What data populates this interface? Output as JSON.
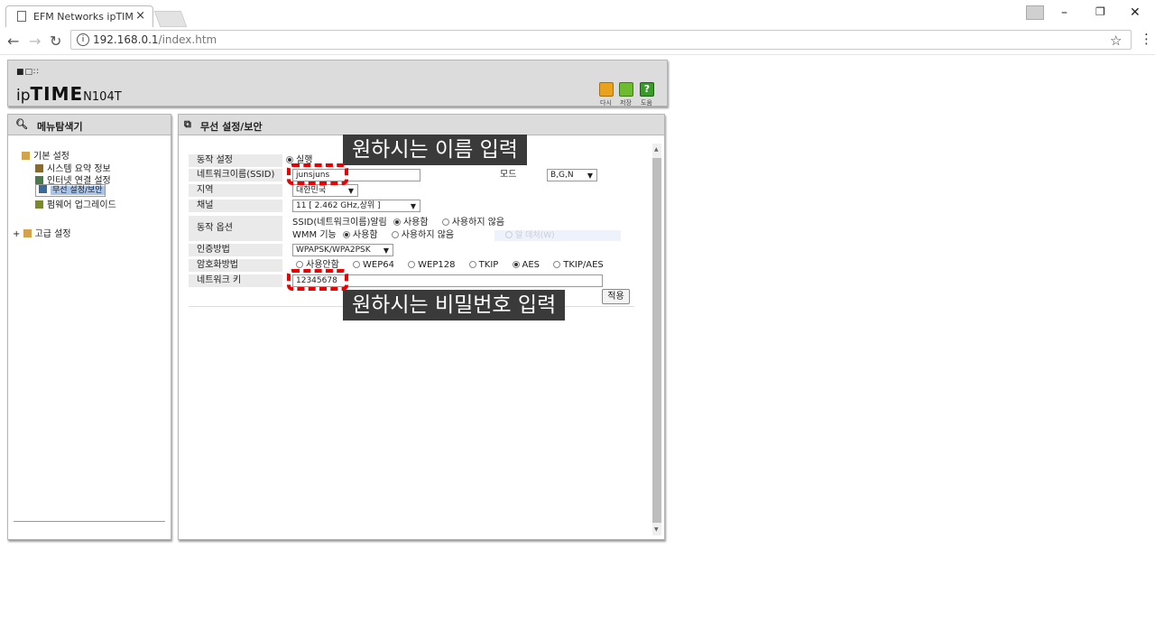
{
  "browser": {
    "tab_title": "EFM Networks ipTIME N",
    "tab_close": "×",
    "url_host": "192.168.0.1",
    "url_path": "/index.htm",
    "info": "i",
    "window_minimize": "–",
    "window_restore": "❐",
    "window_close": "✕"
  },
  "header": {
    "logo_mark": "■□∷",
    "brand_ip": "ip",
    "brand_time": "TIME",
    "model": "N104T",
    "toolbar": [
      {
        "label": "다시",
        "color": "#e8a21c"
      },
      {
        "label": "저장",
        "color": "#6dbb2e"
      },
      {
        "label": "도움",
        "color": "#3a9a2a"
      }
    ],
    "help_glyph": "?"
  },
  "left_panel": {
    "title": "메뉴탐색기",
    "items": [
      {
        "label": "기본 설정"
      },
      {
        "label": "시스템 요약 정보"
      },
      {
        "label": "인터넷 연결 설정"
      },
      {
        "label": "무선 설정/보안"
      },
      {
        "label": "펌웨어 업그레이드"
      },
      {
        "label": "고급 설정"
      }
    ]
  },
  "right_panel": {
    "title": "무선 설정/보안",
    "rows": {
      "operation": {
        "label": "동작 설정",
        "option": "실행"
      },
      "ssid": {
        "label": "네트워크이름(SSID)",
        "value": "junsjuns",
        "mode_label": "모드",
        "mode_value": "B,G,N"
      },
      "region": {
        "label": "지역",
        "value": "대한민국"
      },
      "channel": {
        "label": "채널",
        "value": "11 [ 2.462 GHz,상위 ]"
      },
      "options": {
        "label": "동작 옵션",
        "ssid_broadcast": "SSID(네트워크이름)알림",
        "wmm": "WMM 기능",
        "use": "사용함",
        "no_use": "사용하지 않음",
        "extra": "알 데처(W)"
      },
      "auth": {
        "label": "인증방법",
        "value": "WPAPSK/WPA2PSK"
      },
      "encrypt": {
        "label": "암호화방법",
        "options": [
          "사용안함",
          "WEP64",
          "WEP128",
          "TKIP",
          "AES",
          "TKIP/AES"
        ],
        "selected": "AES"
      },
      "key": {
        "label": "네트워크 키",
        "value": "12345678"
      }
    },
    "apply_label": "적용"
  },
  "annotations": {
    "name_hint": "원하시는 이름 입력",
    "password_hint": "원하시는 비밀번호 입력"
  },
  "colors": {
    "annotation_dash": "#e00000",
    "panel_bg": "#dcdcdc",
    "selected_item": "#a8c4e8"
  }
}
